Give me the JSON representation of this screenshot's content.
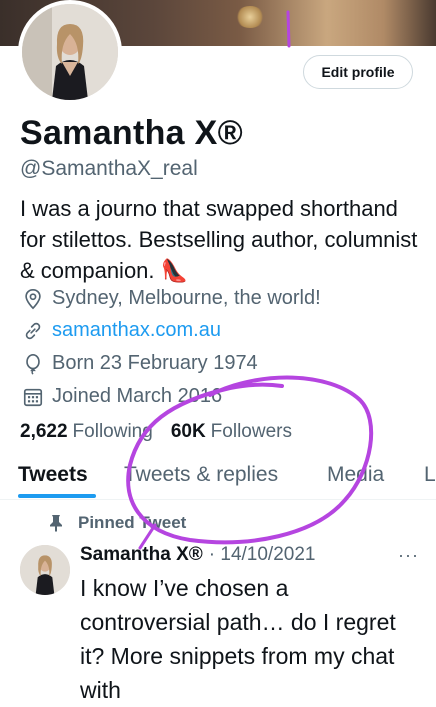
{
  "profile": {
    "edit_button": "Edit profile",
    "name": "Samantha X®",
    "handle": "@SamanthaX_real",
    "bio": "I was a journo that swapped shorthand for stilettos. Bestselling author, columnist & companion. 👠",
    "location": "Sydney, Melbourne, the world!",
    "website": "samanthax.com.au",
    "born": "Born 23 February 1974",
    "joined": "Joined March 2016",
    "following_count": "2,622",
    "following_label": "Following",
    "followers_count": "60K",
    "followers_label": "Followers",
    "icons": [
      "location-pin-icon",
      "link-icon",
      "balloon-icon",
      "calendar-icon"
    ]
  },
  "tabs": [
    {
      "label": "Tweets",
      "active": true
    },
    {
      "label": "Tweets & replies",
      "active": false
    },
    {
      "label": "Media",
      "active": false
    },
    {
      "label": "L",
      "active": false
    }
  ],
  "tweet": {
    "pinned_label": "Pinned Tweet",
    "author": "Samantha X®",
    "date": "· 14/10/2021",
    "more": "···",
    "text": "I know I’ve chosen a controversial path… do I regret it? More snippets from my chat with"
  },
  "colors": {
    "accent": "#1d9bf0",
    "annotation": "#b545e0",
    "secondary_text": "#536471"
  }
}
